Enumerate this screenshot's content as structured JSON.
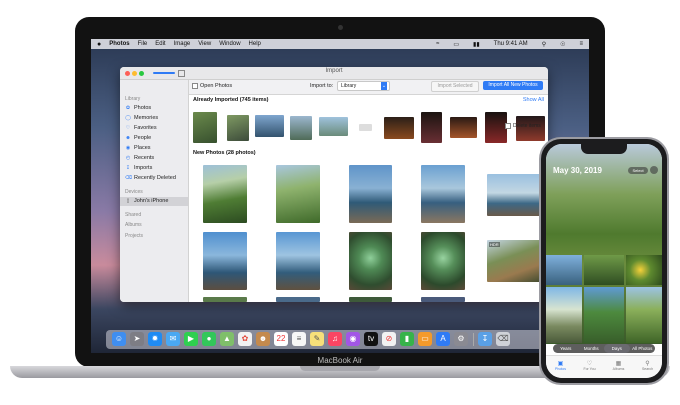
{
  "menubar": {
    "apple": "",
    "app_name": "Photos",
    "items": [
      "File",
      "Edit",
      "Image",
      "View",
      "Window",
      "Help"
    ],
    "clock": "Thu 9:41 AM"
  },
  "window": {
    "title": "Import",
    "import_selected": "Import Selected",
    "import_all": "Import All New Photos",
    "open_photos": "Open Photos",
    "import_to_label": "Import to:",
    "import_to_value": "Library",
    "delete_items": "Delete items"
  },
  "sidebar": {
    "library_header": "Library",
    "library_items": [
      {
        "label": "Photos",
        "icon": "photos-icon"
      },
      {
        "label": "Memories",
        "icon": "memories-icon"
      },
      {
        "label": "Favorites",
        "icon": "heart-icon"
      },
      {
        "label": "People",
        "icon": "person-icon"
      },
      {
        "label": "Places",
        "icon": "pin-icon"
      },
      {
        "label": "Recents",
        "icon": "clock-icon"
      },
      {
        "label": "Imports",
        "icon": "import-icon"
      },
      {
        "label": "Recently Deleted",
        "icon": "trash-icon"
      }
    ],
    "devices_header": "Devices",
    "device": "John's iPhone",
    "shared_header": "Shared",
    "albums_header": "Albums",
    "projects_header": "Projects"
  },
  "content": {
    "already_imported": "Already Imported (745 items)",
    "show_all": "Show All",
    "new_photos": "New Photos (28 photos)"
  },
  "laptop": {
    "brand": "MacBook Air"
  },
  "phone": {
    "date": "May 30, 2019",
    "select": "Select",
    "segments": [
      "Years",
      "Months",
      "Days",
      "All Photos"
    ],
    "active_segment": "Days",
    "tabs": [
      "Photos",
      "For You",
      "Albums",
      "Search"
    ]
  },
  "colors": {
    "accent": "#2f7bf5"
  }
}
